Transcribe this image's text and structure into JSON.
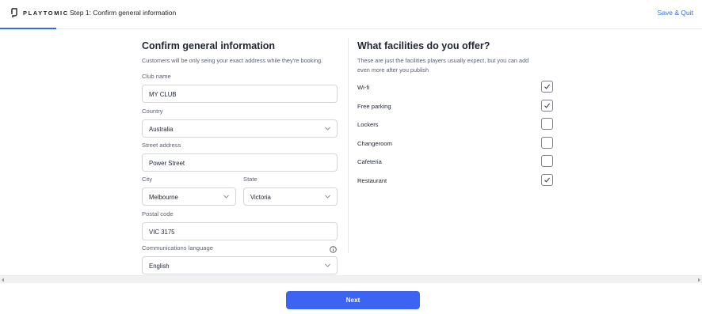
{
  "header": {
    "brand": "PLAYTOMIC",
    "step_title": "Step 1: Confirm general information",
    "save_quit": "Save & Quit",
    "progress": 0.08
  },
  "general": {
    "title": "Confirm general information",
    "subtitle": "Customers will be only seing your exact address while they're booking.",
    "club_name": {
      "label": "Club name",
      "value": "MY CLUB"
    },
    "country": {
      "label": "Country",
      "value": "Australia"
    },
    "street": {
      "label": "Street address",
      "value": "Power Street"
    },
    "city": {
      "label": "City",
      "value": "Melbourne"
    },
    "state": {
      "label": "State",
      "value": "Victoria"
    },
    "postal": {
      "label": "Postal code",
      "value": "VIC 3175"
    },
    "language": {
      "label": "Communications language",
      "value": "English"
    }
  },
  "facilities": {
    "title": "What facilities do you offer?",
    "subtitle_line1": "These are just the facilities players usually expect, but you can add",
    "subtitle_line2": "even more after you publish",
    "items": [
      {
        "label": "Wi-fi",
        "checked": true
      },
      {
        "label": "Free parking",
        "checked": true
      },
      {
        "label": "Lockers",
        "checked": false
      },
      {
        "label": "Changeroom",
        "checked": false
      },
      {
        "label": "Cafeteria",
        "checked": false
      },
      {
        "label": "Restaurant",
        "checked": true
      }
    ]
  },
  "footer": {
    "next_label": "Next"
  },
  "colors": {
    "accent": "#3d63f3",
    "link": "#2f6fe0"
  }
}
